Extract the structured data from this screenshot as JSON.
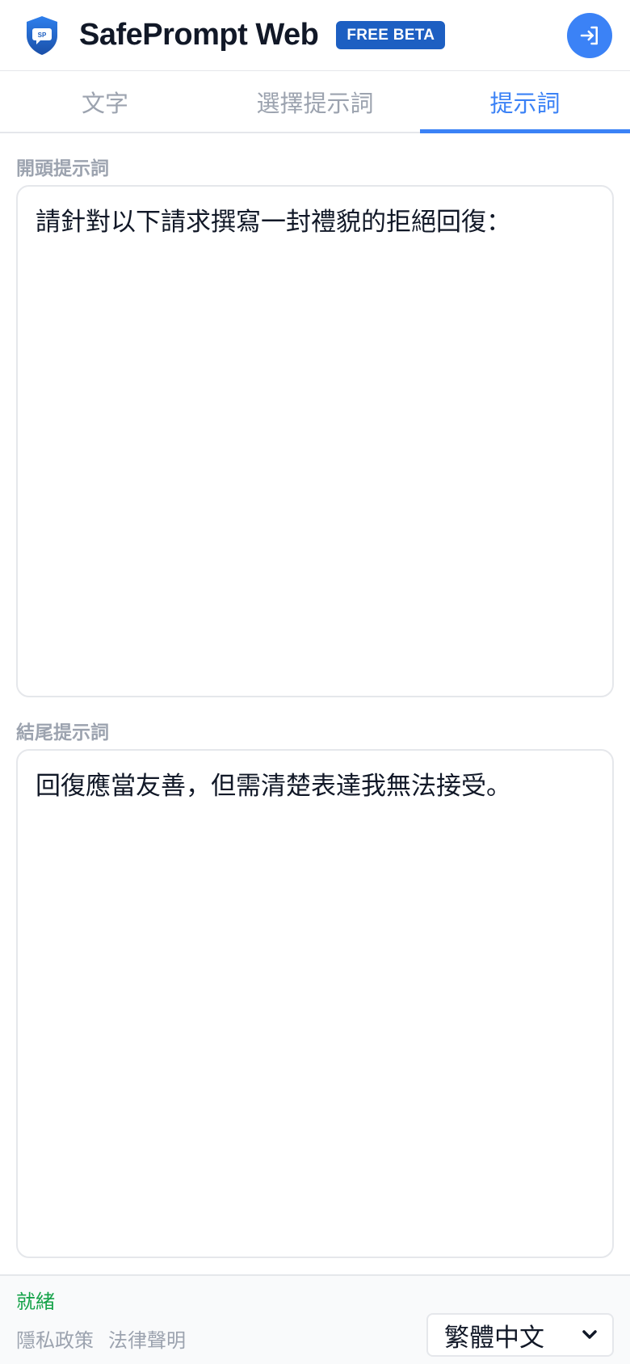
{
  "header": {
    "title": "SafePrompt Web",
    "badge": "FREE BETA",
    "logo_text": "SP",
    "brand_color": "#1d5fc2",
    "accent_color": "#3b82f6"
  },
  "tabs": [
    {
      "label": "文字",
      "active": false
    },
    {
      "label": "選擇提示詞",
      "active": false
    },
    {
      "label": "提示詞",
      "active": true
    }
  ],
  "opening": {
    "label": "開頭提示詞",
    "value": "請針對以下請求撰寫一封禮貌的拒絕回復："
  },
  "closing": {
    "label": "結尾提示詞",
    "value": "回復應當友善，但需清楚表達我無法接受。"
  },
  "footer": {
    "status": "就緒",
    "status_color": "#16a34a",
    "links": [
      "隱私政策",
      "法律聲明"
    ],
    "language": "繁體中文"
  }
}
